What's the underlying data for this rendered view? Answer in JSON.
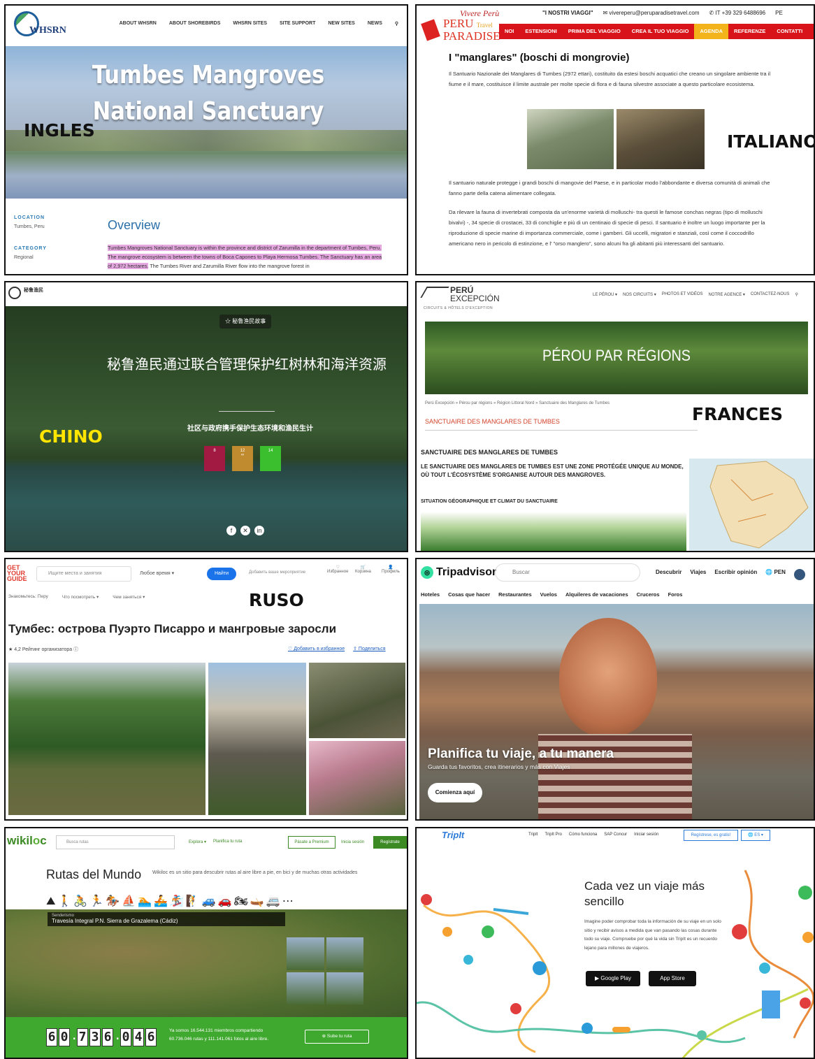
{
  "labels": {
    "english": "INGLES",
    "italian": "ITALIANO",
    "chinese": "CHINO",
    "french": "FRANCES",
    "russian": "RUSO"
  },
  "whsrn": {
    "logo": "WHSRN",
    "nav": [
      "ABOUT WHSRN",
      "ABOUT SHOREBIRDS",
      "WHSRN SITES",
      "SITE SUPPORT",
      "NEW SITES",
      "NEWS"
    ],
    "title": "Tumbes Mangroves National Sanctuary",
    "location_label": "LOCATION",
    "location_value": "Tumbes, Peru",
    "category_label": "CATEGORY",
    "category_value": "Regional",
    "overview": "Overview",
    "text_highlight": "Tumbes Mangroves National Sanctuary is within the province and district of Zarumilla in the department of Tumbes, Peru. The mangrove ecosystem is between the towns of Boca Capones to Playa Hermosa Tumbes. The Sanctuary has an area of 2,972 hectares.",
    "text_rest": " The Tumbes River and Zarumilla River flow into the mangrove forest in"
  },
  "peru_paradise": {
    "logo_script": "Vivere Perù",
    "logo_main": "PERU",
    "logo_sub": "Travel",
    "logo_paradise": "PARADISE",
    "viaggi": "\"I NOSTRI VIAGGI\"",
    "email": "vivereperu@peruparadisetravel.com",
    "phone": "IT +39 329 6488696",
    "lang": "PE",
    "nav": [
      "NOI",
      "ESTENSIONI",
      "PRIMA DEL VIAGGIO",
      "CREA IL TUO VIAGGIO",
      "AGENDA",
      "REFERENZE",
      "CONTATTI"
    ],
    "active_nav": "AGENDA",
    "heading": "I \"manglares\" (boschi di mongrovie)",
    "p1": "Il Santuario Nazionale dei Manglares di Tumbes (2972 ettari), costituito da estesi boschi acquatici che creano un singolare ambiente tra il fiume e il mare, costituisce il limite australe per molte specie di flora e di fauna silvestre associate a questo particolare ecosistema.",
    "p2": "Il santuario naturale protegge i grandi boschi di mangovie del Paese, e in particolar modo l'abbondante e diversa comunità di animali che fanno parte della catena alimentare collegata.",
    "p3": "Da rilevare la fauna di invertebrati composta da un'enorme varietà di molluschi- tra questi le famose conchas negras (tipo di molluschi bivalvi) -, 34 specie di crostacei, 33 di conchiglie e più di un centinaio di specie di pesci. Il santuario è inoltre un luogo importante per la riproduzione di specie marine di importanza commerciale, come i gamberi. Gli uccelli, migratori e stanziali, così come il coccodrillo americano nero in pericolo di estinzione, e l' \"orso manglero\", sono alcuni fra gli abitanti più interessanti del santuario."
  },
  "chinese": {
    "logo": "秘鲁渔民",
    "chip": "☆ 秘鲁渔民故事",
    "title": "秘鲁渔民通过联合管理保护红树林和海洋资源",
    "subtitle": "社区与政府携手保护生态环境和渔民生计",
    "sdgs": [
      {
        "n": "8",
        "c": "#a21942"
      },
      {
        "n": "12",
        "c": "#bf8b2e"
      },
      {
        "n": "14",
        "c": "#3cbf2f"
      }
    ],
    "social": [
      "f",
      "✕",
      "in"
    ]
  },
  "peru_exception": {
    "logo1": "PERÚ",
    "logo2": "EXCEPCIÓN",
    "logo3": "CIRCUITS & HÔTELS D'EXCEPTION",
    "nav": [
      "LE PÉROU ▾",
      "NOS CIRCUITS ▾",
      "PHOTOS ET VIDÉOS",
      "NOTRE AGENCE ▾",
      "CONTACTEZ-NOUS"
    ],
    "band": "PÉROU PAR RÉGIONS",
    "breadcrumb": "Perú Excepción » Pérou par régions » Région Littoral Nord » Sanctuaire des Manglares de Tumbes",
    "red_title": "SANCTUAIRE DES MANGLARES DE TUMBES",
    "section": "SANCTUAIRE DES MANGLARES DE TUMBES",
    "lead": "LE SANCTUAIRE DES MANGLARES DE TUMBES EST UNE ZONE PROTÉGÉE UNIQUE AU MONDE, OÙ TOUT L'ÉCOSYSTÈME S'ORGANISE AUTOUR DES MANGROVES.",
    "sit": "SITUATION GÉOGRAPHIQUE ET CLIMAT DU SANCTUAIRE"
  },
  "gyg": {
    "logo": "GET YOUR GUIDE",
    "search": "Ищите места и занятия",
    "time": "Любое время ▾",
    "find": "Найти",
    "add": "Добавить ваше мероприятие",
    "icons": [
      "Избранное",
      "Корзина",
      "Профиль"
    ],
    "tabs": [
      "Знакомьтесь: Перу",
      "Что посмотреть ▾",
      "Чем заняться ▾"
    ],
    "title": "Тумбес: острова Пуэрто Писарро и мангровые заросли",
    "rating": "★ 4,2 Рейтинг организатора ⓘ",
    "actions": [
      "♡ Добавить в избранное",
      "⇪ Поделиться"
    ]
  },
  "tripadvisor": {
    "logo": "Tripadvisor",
    "search": "Buscar",
    "nav": [
      "Descubrir",
      "Viajes",
      "Escribir opinión",
      "PEN"
    ],
    "cats": [
      "Hoteles",
      "Cosas que hacer",
      "Restaurantes",
      "Vuelos",
      "Alquileres de vacaciones",
      "Cruceros",
      "Foros"
    ],
    "headline": "Planifica tu viaje, a tu manera",
    "sub": "Guarda tus favoritos, crea itinerarios y más con Viajes",
    "cta": "Comienza aquí"
  },
  "wikiloc": {
    "logo_a": "wikil",
    "logo_b": "o",
    "logo_c": "c",
    "search": "Busca rutas",
    "nav": [
      "Explora ▾",
      "Planifica tu ruta"
    ],
    "premium": "Pásate a Premium",
    "login": "Inicia sesión",
    "register": "Regístrate",
    "title": "Rutas del Mundo",
    "desc": "Wikiloc es un sitio para descubrir rutas al aire libre a pie, en bici y de muchas otras actividades",
    "activities": "⛰🚶🚴🏃🏇⛵🏊🚣🏂🧗🚙🚗🏍🛶🚐⋯",
    "route_label": "Senderismo",
    "route": "Travesía Integral P.N. Sierra de Grazalema (Cádiz)",
    "counter": [
      "6",
      "0",
      ".",
      "7",
      "3",
      "6",
      ".",
      "0",
      "4",
      "6"
    ],
    "stats1": "Ya somos 16.544.131 miembros compartiendo",
    "stats2": "60.736.046 rutas y 111.141.061 fotos al aire libre.",
    "upload": "⊕ Sube tu ruta"
  },
  "tripit": {
    "logo": "TripIt",
    "nav": [
      "TripIt",
      "TripIt Pro",
      "Cómo funciona",
      "SAP Concur",
      "Iniciar sesión"
    ],
    "register": "Regístrese, es gratis!",
    "lang": "🌐 ES ▾",
    "title": "Cada vez un viaje más sencillo",
    "text": "Imagine poder comprobar toda la información de su viaje en un solo sitio y recibir avisos a medida que van pasando las cosas durante todo su viaje. Compruebe por qué la vida sin TripIt es un recuerdo lejano para millones de viajeros.",
    "gplay": "▶ Google Play",
    "appstore": " App Store"
  }
}
